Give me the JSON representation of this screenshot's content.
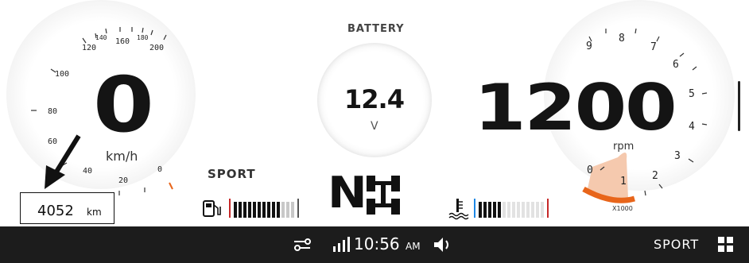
{
  "speedometer": {
    "value": "0",
    "unit": "km/h",
    "ticks": [
      "0",
      "20",
      "40",
      "60",
      "80",
      "100",
      "120",
      "140",
      "160",
      "180",
      "200"
    ]
  },
  "battery": {
    "title": "BATTERY",
    "value": "12.4",
    "unit": "V"
  },
  "tachometer": {
    "value": "1200",
    "unit": "rpm",
    "multiplier": "X1000",
    "ticks": [
      "0",
      "1",
      "2",
      "3",
      "4",
      "5",
      "6",
      "7",
      "8",
      "9"
    ]
  },
  "drive_mode": {
    "label": "SPORT"
  },
  "odometer": {
    "value": "4052",
    "unit": "km"
  },
  "gear": {
    "value": "N"
  },
  "fuel_gauge": {
    "level_fraction": 0.6,
    "icon": "fuel-pump-icon"
  },
  "coolant_gauge": {
    "level_fraction": 0.4,
    "icon": "coolant-temperature-icon"
  },
  "status_bar": {
    "time": "10:56",
    "ampm": "AM",
    "mode": "SPORT",
    "icons": [
      "key-icon",
      "signal-icon",
      "volume-icon",
      "grid-menu-icon"
    ]
  },
  "colors": {
    "accent_orange": "#e8651a",
    "rpm_zone": "#f5c9ae",
    "fuel_red": "#c62828",
    "coolant_blue": "#1e88e5",
    "status_bar_bg": "#1c1c1c"
  }
}
